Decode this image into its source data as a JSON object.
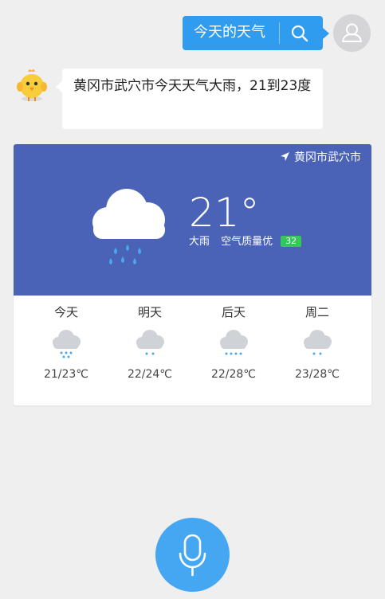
{
  "user_query": {
    "text": "今天的天气",
    "search_icon": "search-icon"
  },
  "avatar": {
    "icon": "user-avatar-icon"
  },
  "assistant": {
    "icon": "chick-mascot-icon",
    "reply": "黄冈市武穴市今天天气大雨，21到23度"
  },
  "weather_card": {
    "location": "黄冈市武穴市",
    "location_icon": "location-arrow-icon",
    "temperature": "21°",
    "condition": "大雨",
    "air_quality_label": "空气质量优",
    "aqi": "32",
    "colors": {
      "header": "#4a63b7",
      "aqi_badge": "#35c759",
      "accent": "#2f9cf0"
    },
    "forecast": [
      {
        "day": "今天",
        "temp": "21/23℃",
        "icon": "heavy-rain-icon"
      },
      {
        "day": "明天",
        "temp": "22/24℃",
        "icon": "rain-icon"
      },
      {
        "day": "后天",
        "temp": "22/28℃",
        "icon": "rain-icon"
      },
      {
        "day": "周二",
        "temp": "23/28℃",
        "icon": "rain-icon"
      }
    ]
  },
  "voice": {
    "icon": "microphone-icon"
  }
}
